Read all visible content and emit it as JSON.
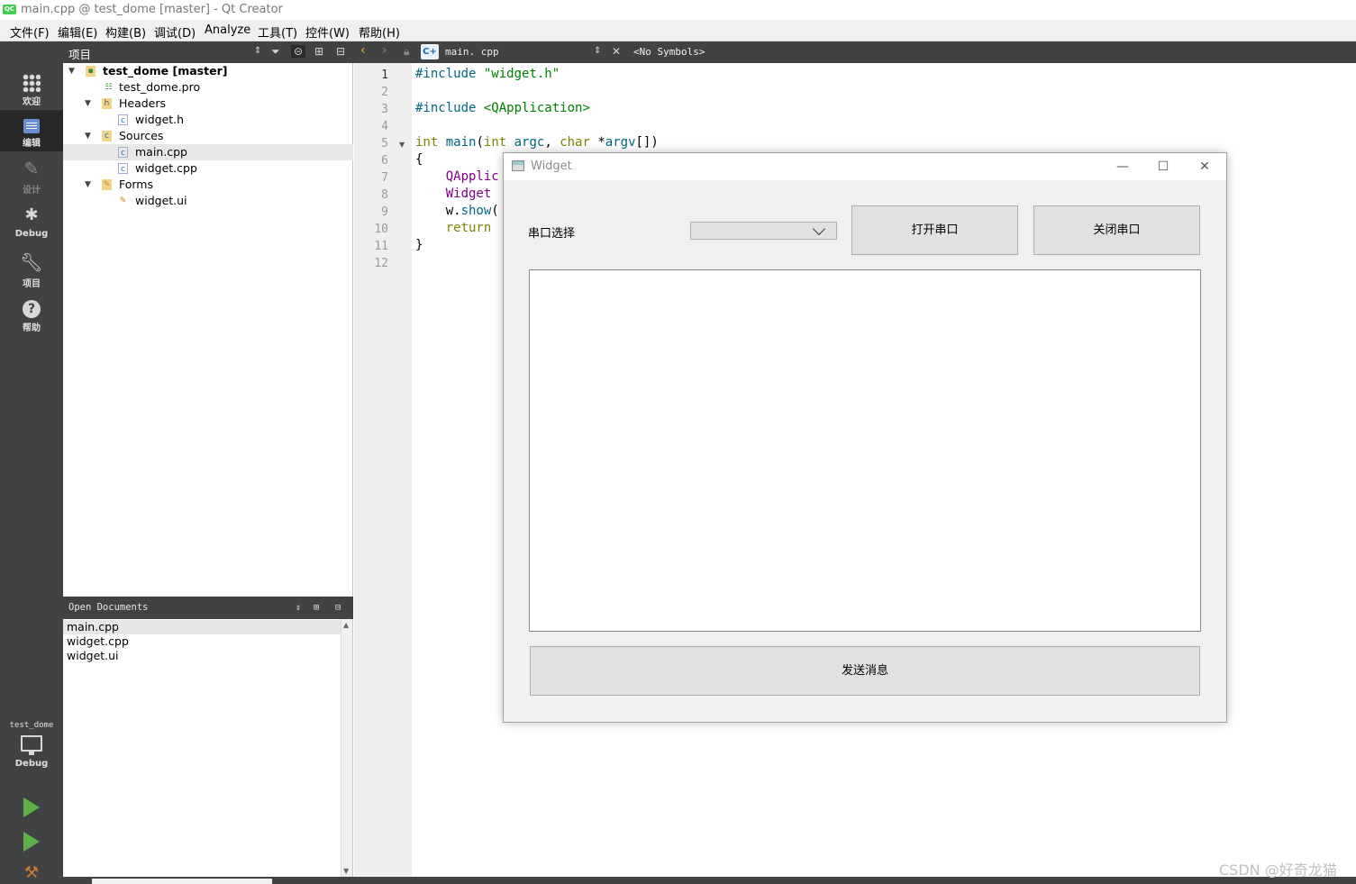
{
  "window": {
    "title": "main.cpp @ test_dome [master] - Qt Creator",
    "app_icon": "QC"
  },
  "menu": [
    "文件(F)",
    "编辑(E)",
    "构建(B)",
    "调试(D)",
    "Analyze",
    "工具(T)",
    "控件(W)",
    "帮助(H)"
  ],
  "toolbar": {
    "projects_label": "项目",
    "open_file": "main. cpp",
    "symbols": "<No Symbols>"
  },
  "modes": [
    {
      "label": "欢迎",
      "icon": "grid-icon"
    },
    {
      "label": "编辑",
      "icon": "edit-doc-icon"
    },
    {
      "label": "设计",
      "icon": "pencil-icon"
    },
    {
      "label": "Debug",
      "icon": "bug-icon"
    },
    {
      "label": "项目",
      "icon": "wrench-icon"
    },
    {
      "label": "帮助",
      "icon": "help-icon"
    }
  ],
  "kit": {
    "project": "test_dome",
    "config": "Debug"
  },
  "project_tree": [
    {
      "label": "test_dome [master]",
      "level": 0,
      "expanded": true,
      "kind": "project"
    },
    {
      "label": "test_dome.pro",
      "level": 1,
      "kind": "pro"
    },
    {
      "label": "Headers",
      "level": 1,
      "expanded": true,
      "kind": "folder-h"
    },
    {
      "label": "widget.h",
      "level": 2,
      "kind": "header"
    },
    {
      "label": "Sources",
      "level": 1,
      "expanded": true,
      "kind": "folder-cpp"
    },
    {
      "label": "main.cpp",
      "level": 2,
      "kind": "cpp",
      "selected": true
    },
    {
      "label": "widget.cpp",
      "level": 2,
      "kind": "cpp"
    },
    {
      "label": "Forms",
      "level": 1,
      "expanded": true,
      "kind": "folder-ui"
    },
    {
      "label": "widget.ui",
      "level": 2,
      "kind": "ui"
    }
  ],
  "open_documents": {
    "title": "Open Documents",
    "items": [
      "main.cpp",
      "widget.cpp",
      "widget.ui"
    ]
  },
  "editor": {
    "current_line": 1,
    "line_numbers": [
      "1",
      "2",
      "3",
      "4",
      "5",
      "6",
      "7",
      "8",
      "9",
      "10",
      "11",
      "12"
    ],
    "lines": [
      "#include \"widget.h\"",
      "",
      "#include <QApplication>",
      "",
      "int main(int argc, char *argv[])",
      "{",
      "    QApplic",
      "    Widget ",
      "    w.show(",
      "    return ",
      "}",
      ""
    ]
  },
  "widget_window": {
    "title": "Widget",
    "port_label": "串口选择",
    "combo_value": "",
    "open_button": "打开串口",
    "close_button": "关闭串口",
    "text_content": "",
    "send_button": "发送消息"
  },
  "watermark": "CSDN @好奇龙猫"
}
